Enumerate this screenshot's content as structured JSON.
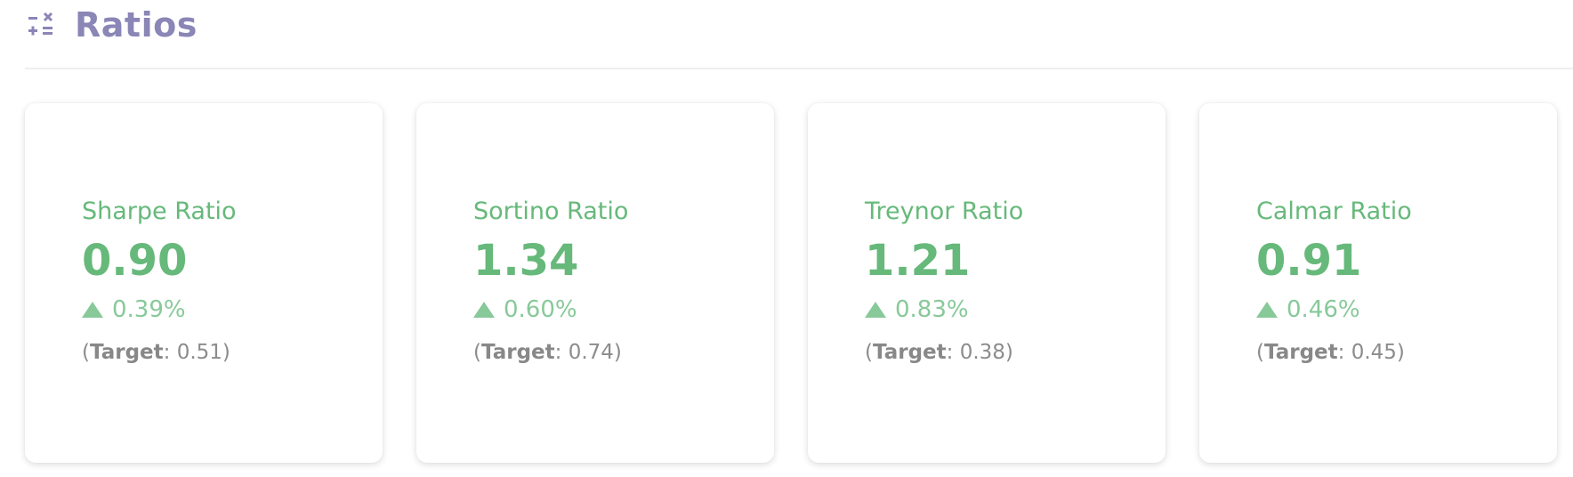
{
  "header": {
    "icon": "calculator-ops-icon",
    "title": "Ratios",
    "accent_color": "#8a86b6"
  },
  "cards": [
    {
      "title": "Sharpe Ratio",
      "value": "0.90",
      "change_icon": "arrow-up-triangle-icon",
      "change": "0.39%",
      "target_label": "Target",
      "target_value": "0.51"
    },
    {
      "title": "Sortino Ratio",
      "value": "1.34",
      "change_icon": "arrow-up-triangle-icon",
      "change": "0.60%",
      "target_label": "Target",
      "target_value": "0.74"
    },
    {
      "title": "Treynor Ratio",
      "value": "1.21",
      "change_icon": "arrow-up-triangle-icon",
      "change": "0.83%",
      "target_label": "Target",
      "target_value": "0.38"
    },
    {
      "title": "Calmar Ratio",
      "value": "0.91",
      "change_icon": "arrow-up-triangle-icon",
      "change": "0.46%",
      "target_label": "Target",
      "target_value": "0.45"
    }
  ],
  "colors": {
    "positive": "#66b97a",
    "positive_light": "#88c99a",
    "muted": "#8c8c8c"
  }
}
